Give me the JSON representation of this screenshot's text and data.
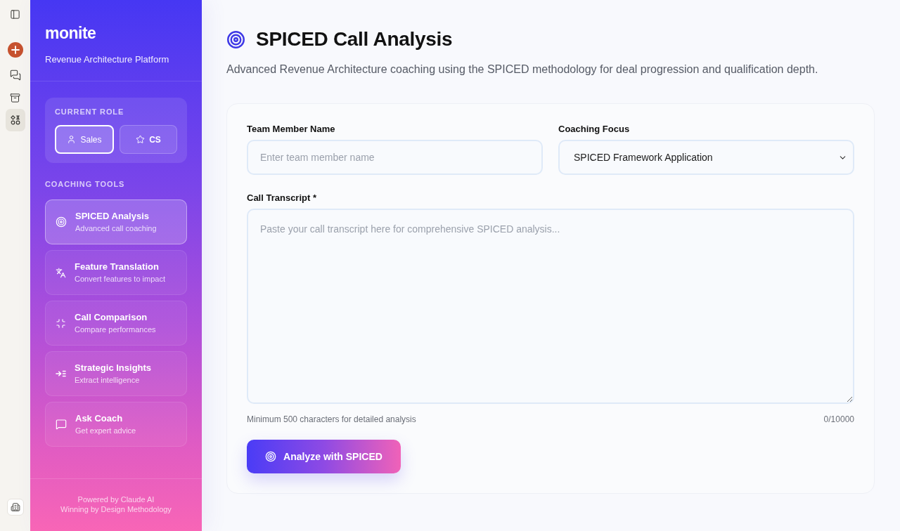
{
  "rail": {
    "top_items": [
      {
        "kind": "panel",
        "selected": false
      },
      {
        "kind": "new",
        "selected": false
      },
      {
        "kind": "chats",
        "selected": false
      },
      {
        "kind": "projects",
        "selected": false
      },
      {
        "kind": "artifacts",
        "selected": true
      }
    ],
    "bottom_items": [
      {
        "kind": "workspace",
        "selected": false
      }
    ]
  },
  "sidebar": {
    "logo": "monite",
    "subtitle": "Revenue Architecture Platform",
    "role_title": "CURRENT ROLE",
    "roles": [
      {
        "kind": "user",
        "label": "Sales",
        "selected": true
      },
      {
        "kind": "star",
        "label": "CS",
        "selected": false
      }
    ],
    "tools_title": "COACHING TOOLS",
    "tools": [
      {
        "kind": "target",
        "title": "SPICED Analysis",
        "subtitle": "Advanced call coaching",
        "selected": true
      },
      {
        "kind": "translate",
        "title": "Feature Translation",
        "subtitle": "Convert features to impact",
        "selected": false
      },
      {
        "kind": "compare",
        "title": "Call Comparison",
        "subtitle": "Compare performances",
        "selected": false
      },
      {
        "kind": "insights",
        "title": "Strategic Insights",
        "subtitle": "Extract intelligence",
        "selected": false
      },
      {
        "kind": "chat",
        "title": "Ask Coach",
        "subtitle": "Get expert advice",
        "selected": false
      }
    ],
    "footer": [
      "Powered by Claude AI",
      "Winning by Design Methodology"
    ]
  },
  "main": {
    "title": "SPICED Call Analysis",
    "description": "Advanced Revenue Architecture coaching using the SPICED methodology for deal progression and qualification depth.",
    "form": {
      "name_field": {
        "label": "Team Member Name",
        "placeholder": "Enter team member name"
      },
      "focus_field": {
        "label": "Coaching Focus",
        "value": "SPICED Framework Application"
      },
      "transcript_field": {
        "label": "Call Transcript *",
        "placeholder": "Paste your call transcript here for comprehensive SPICED analysis..."
      },
      "hint": "Minimum 500 characters for detailed analysis",
      "counter": "0/10000",
      "submit": "Analyze with SPICED"
    }
  }
}
